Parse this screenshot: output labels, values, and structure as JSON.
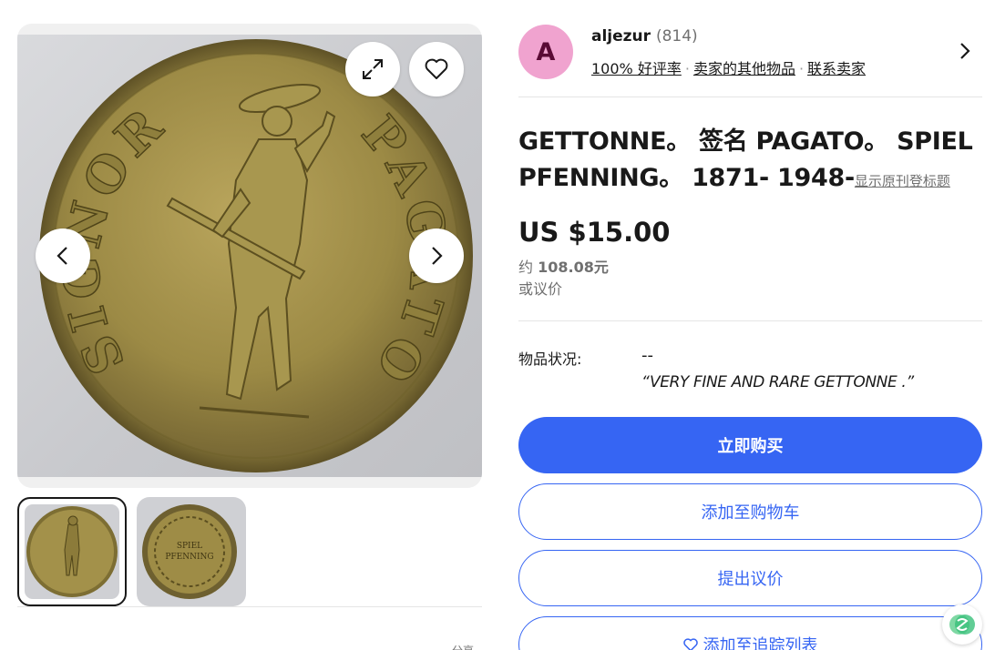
{
  "gallery": {
    "expand_label": "expand",
    "watch_label": "watch",
    "prev_label": "previous",
    "next_label": "next",
    "coin_legend_left": "SIGNOR",
    "coin_legend_right": "PAGATO",
    "thumb2_text_line1": "SPIEL",
    "thumb2_text_line2": "PFENNING",
    "cut_off_text": "分享"
  },
  "seller": {
    "avatar_letter": "A",
    "name": "aljezur",
    "feedback_count": "(814)",
    "positive_rate": "100% 好评率",
    "other_items": "卖家的其他物品",
    "contact": "联系卖家",
    "separator": "·"
  },
  "listing": {
    "title": "GETTONNE。 签名 PAGATO。 SPIEL PFENNING。 1871- 1948-",
    "show_original_title": "显示原刊登标题",
    "price": "US $15.00",
    "approx_prefix": "约",
    "approx_value": "108.08元",
    "or_best_offer": "或议价",
    "condition_label": "物品状况:",
    "condition_value": "--",
    "condition_description": "“VERY FINE AND RARE GETTONNE .”"
  },
  "actions": {
    "buy_now": "立即购买",
    "add_to_cart": "添加至购物车",
    "make_offer": "提出议价",
    "add_to_watchlist": "添加至追踪列表"
  },
  "colors": {
    "primary": "#3665f3",
    "avatar_bg": "#f0a3cf",
    "text": "#191919",
    "muted": "#707070",
    "coin_brass": "#9c8a45"
  },
  "icons": {
    "expand": "expand-icon",
    "heart": "heart-icon",
    "prev": "chevron-left-icon",
    "next": "chevron-right-icon",
    "seller_chevron": "chevron-right-icon",
    "watch_heart": "heart-icon",
    "assistant": "assistant-logo-icon"
  }
}
